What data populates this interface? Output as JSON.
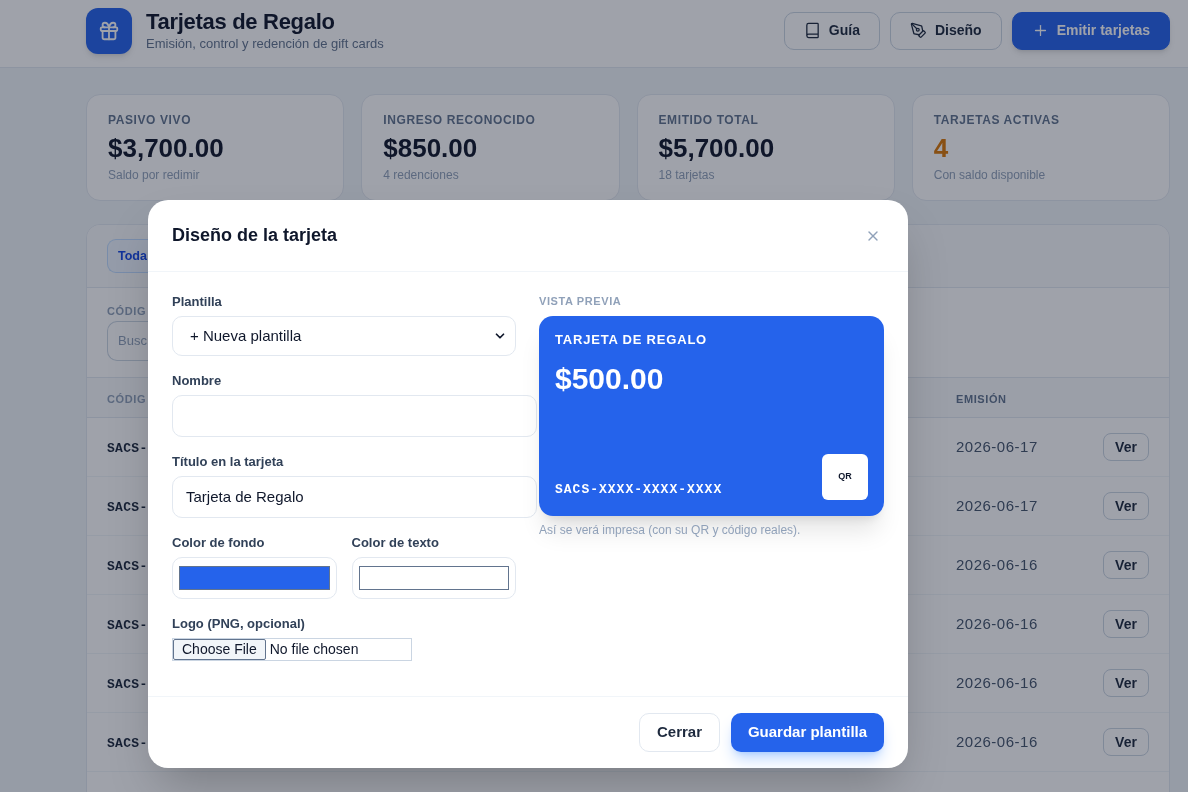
{
  "header": {
    "title": "Tarjetas de Regalo",
    "subtitle": "Emisión, control y redención de gift cards",
    "buttons": [
      {
        "label": "Guía",
        "kind": "outline"
      },
      {
        "label": "Diseño",
        "kind": "outline"
      },
      {
        "label": "Emitir tarjetas",
        "kind": "primary"
      }
    ]
  },
  "stats": [
    {
      "label": "PASIVO VIVO",
      "value": "$3,700.00",
      "note": "Saldo por redimir",
      "kind": "money"
    },
    {
      "label": "INGRESO RECONOCIDO",
      "value": "$850.00",
      "note": "4 redenciones",
      "kind": "money"
    },
    {
      "label": "EMITIDO TOTAL",
      "value": "$5,700.00",
      "note": "18 tarjetas",
      "kind": "money"
    },
    {
      "label": "TARJETAS ACTIVAS",
      "value": "4",
      "note": "Con saldo disponible",
      "kind": "count"
    }
  ],
  "panel": {
    "tabs": [
      {
        "label": "Toda",
        "selected": true
      }
    ],
    "filter": {
      "label": "CÓDIG",
      "placeholder": "Busc"
    },
    "table": {
      "columns": [
        "CÓDIG",
        "EMISIÓN"
      ],
      "rows": [
        {
          "code": "SACS-",
          "date": "2026-06-17",
          "action": "Ver"
        },
        {
          "code": "SACS-",
          "date": "2026-06-17",
          "action": "Ver"
        },
        {
          "code": "SACS-",
          "date": "2026-06-16",
          "action": "Ver"
        },
        {
          "code": "SACS-",
          "date": "2026-06-16",
          "action": "Ver"
        },
        {
          "code": "SACS-",
          "date": "2026-06-16",
          "action": "Ver"
        },
        {
          "code": "SACS-",
          "date": "2026-06-16",
          "action": "Ver"
        }
      ]
    }
  },
  "modal": {
    "title": "Diseño de la tarjeta",
    "form": {
      "template": {
        "label": "Plantilla",
        "value": "+ Nueva plantilla"
      },
      "name": {
        "label": "Nombre"
      },
      "card_title": {
        "label": "Título en la tarjeta",
        "value": "Tarjeta de Regalo"
      },
      "background_color": {
        "label": "Color de fondo",
        "color": "#2563eb"
      },
      "text_color": {
        "label": "Color de texto",
        "color": "#ffffff"
      },
      "logo": {
        "label": "Logo (PNG, opcional)",
        "button": "Choose File",
        "status": "No file chosen"
      }
    },
    "preview": {
      "label": "VISTA PREVIA",
      "card": {
        "title": "TARJETA DE REGALO",
        "amount": "$500.00",
        "code": "SACS-XXXX-XXXX-XXXX",
        "qr": "QR"
      },
      "caption": "Así se verá impresa (con su QR y código reales)."
    },
    "buttons": [
      {
        "label": "Cerrar",
        "kind": "secondary"
      },
      {
        "label": "Guardar plantilla",
        "kind": "primary"
      }
    ]
  }
}
